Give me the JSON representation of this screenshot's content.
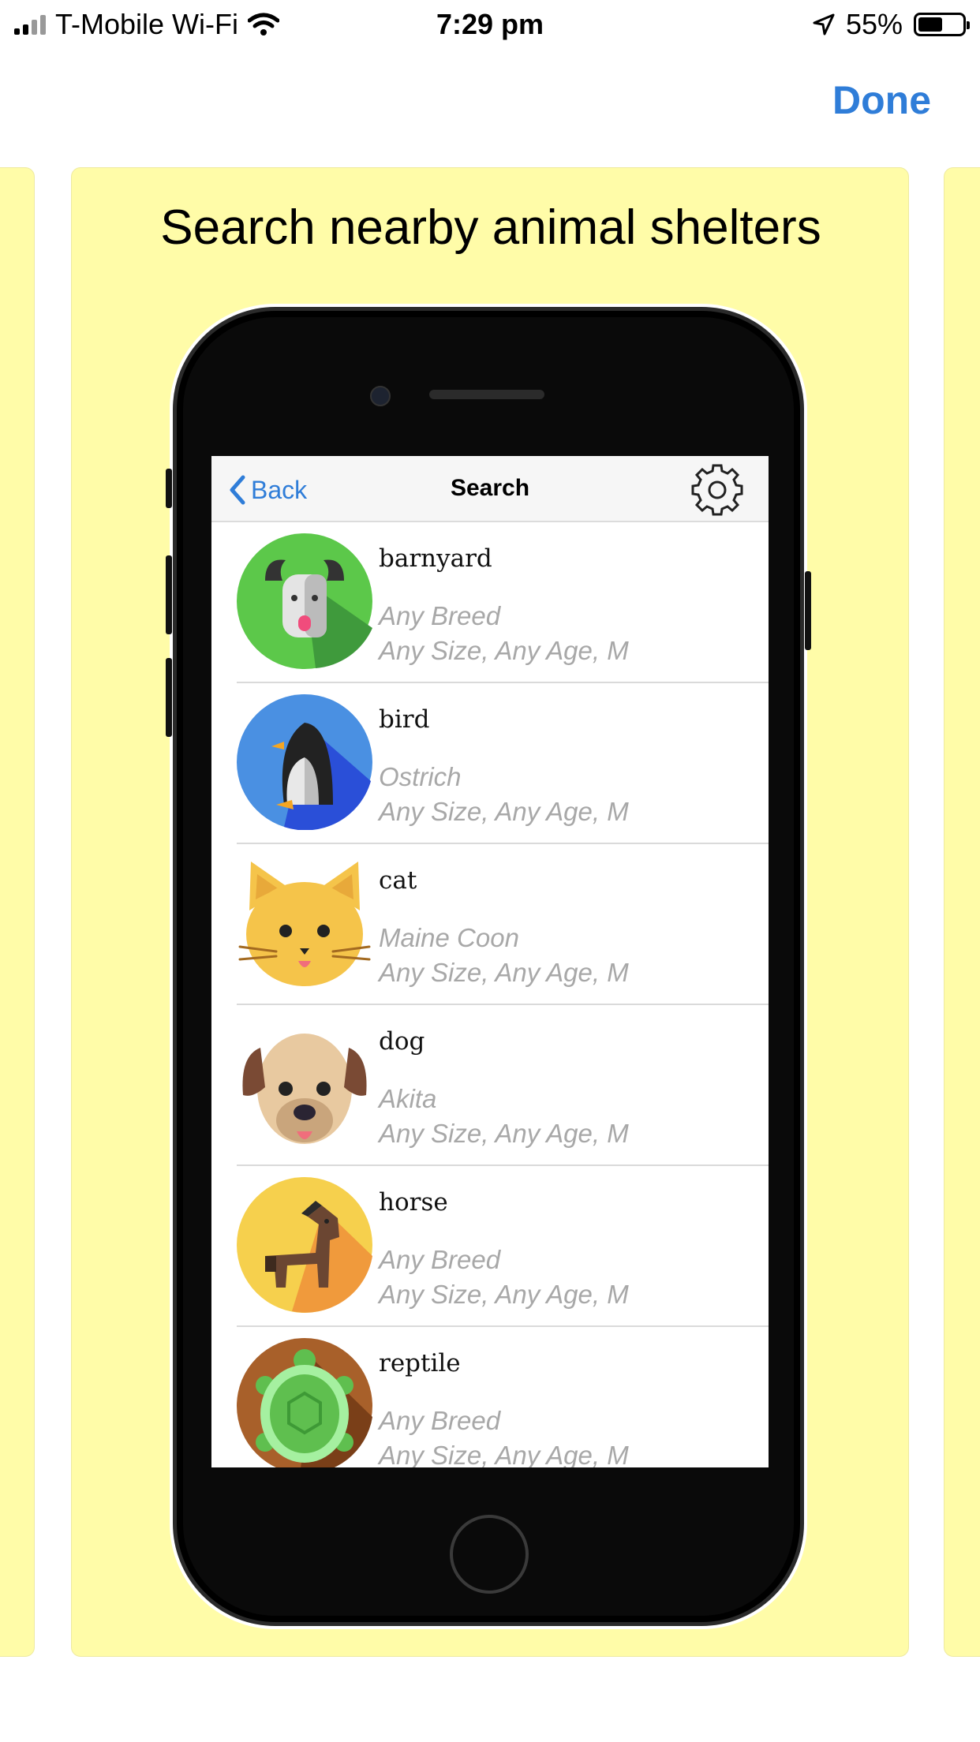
{
  "status_bar": {
    "carrier": "T-Mobile Wi-Fi",
    "time": "7:29 pm",
    "battery": "55%"
  },
  "header": {
    "done_label": "Done"
  },
  "card": {
    "title": "Search nearby animal shelters",
    "colors": {
      "background": "#fffca8",
      "accent": "#2f7dd8"
    }
  },
  "inner_app": {
    "nav": {
      "back_label": "Back",
      "title": "Search"
    },
    "rows": [
      {
        "name": "barnyard",
        "breed": "Any Breed",
        "details": "Any Size, Any Age, M",
        "icon": "goat-icon"
      },
      {
        "name": "bird",
        "breed": "Ostrich",
        "details": "Any Size, Any Age, M",
        "icon": "penguin-icon"
      },
      {
        "name": "cat",
        "breed": "Maine Coon",
        "details": "Any Size, Any Age, M",
        "icon": "cat-icon"
      },
      {
        "name": "dog",
        "breed": "Akita",
        "details": "Any Size, Any Age, M",
        "icon": "dog-icon"
      },
      {
        "name": "horse",
        "breed": "Any Breed",
        "details": "Any Size, Any Age, M",
        "icon": "horse-icon"
      },
      {
        "name": "reptile",
        "breed": "Any Breed",
        "details": "Any Size, Any Age, M",
        "icon": "turtle-icon"
      }
    ]
  }
}
